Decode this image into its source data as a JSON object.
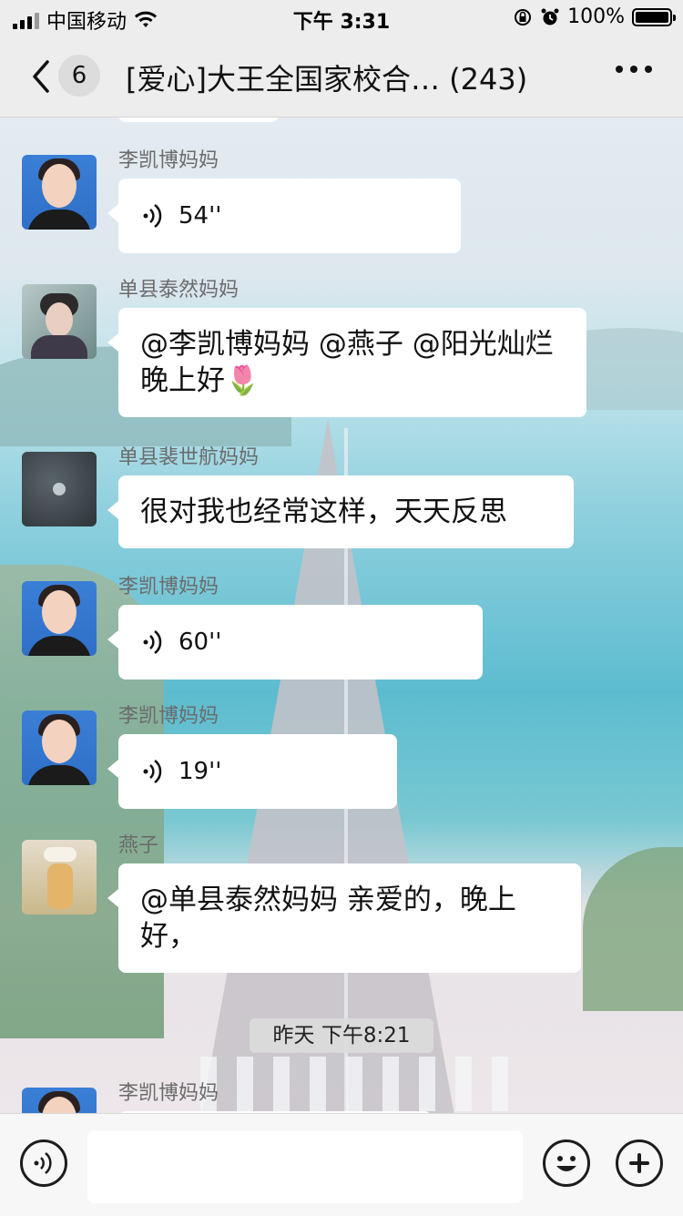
{
  "status_bar": {
    "carrier": "中国移动",
    "time": "下午 3:31",
    "battery": "100%"
  },
  "nav": {
    "unread_count": "6",
    "title": "[爱心]大王全国家校合…",
    "member_count": "(243)",
    "icons": [
      "chevron-left-icon",
      "more-dots-icon"
    ]
  },
  "messages": [
    {
      "sender": "李凯博妈妈",
      "type": "voice",
      "duration": "54''"
    },
    {
      "sender": "单县泰然妈妈",
      "type": "text",
      "text": "@李凯博妈妈 @燕子 @阳光灿烂 晚上好🌷"
    },
    {
      "sender": "单县裴世航妈妈",
      "type": "text",
      "text": "很对我也经常这样，天天反思"
    },
    {
      "sender": "李凯博妈妈",
      "type": "voice",
      "duration": "60''"
    },
    {
      "sender": "李凯博妈妈",
      "type": "voice",
      "duration": "19''"
    },
    {
      "sender": "燕子",
      "type": "text",
      "text": "@单县泰然妈妈 亲爱的，晚上好，"
    },
    {
      "sender": "李凯博妈妈",
      "type": "partial"
    }
  ],
  "timestamp_divider": "昨天 下午8:21",
  "input_bar": {
    "icons": [
      "voice-input-icon",
      "emoji-icon",
      "plus-icon"
    ]
  },
  "colors": {
    "bar_bg": "#ededed",
    "bubble_bg": "#ffffff",
    "sender_name": "#6b6b6b"
  }
}
